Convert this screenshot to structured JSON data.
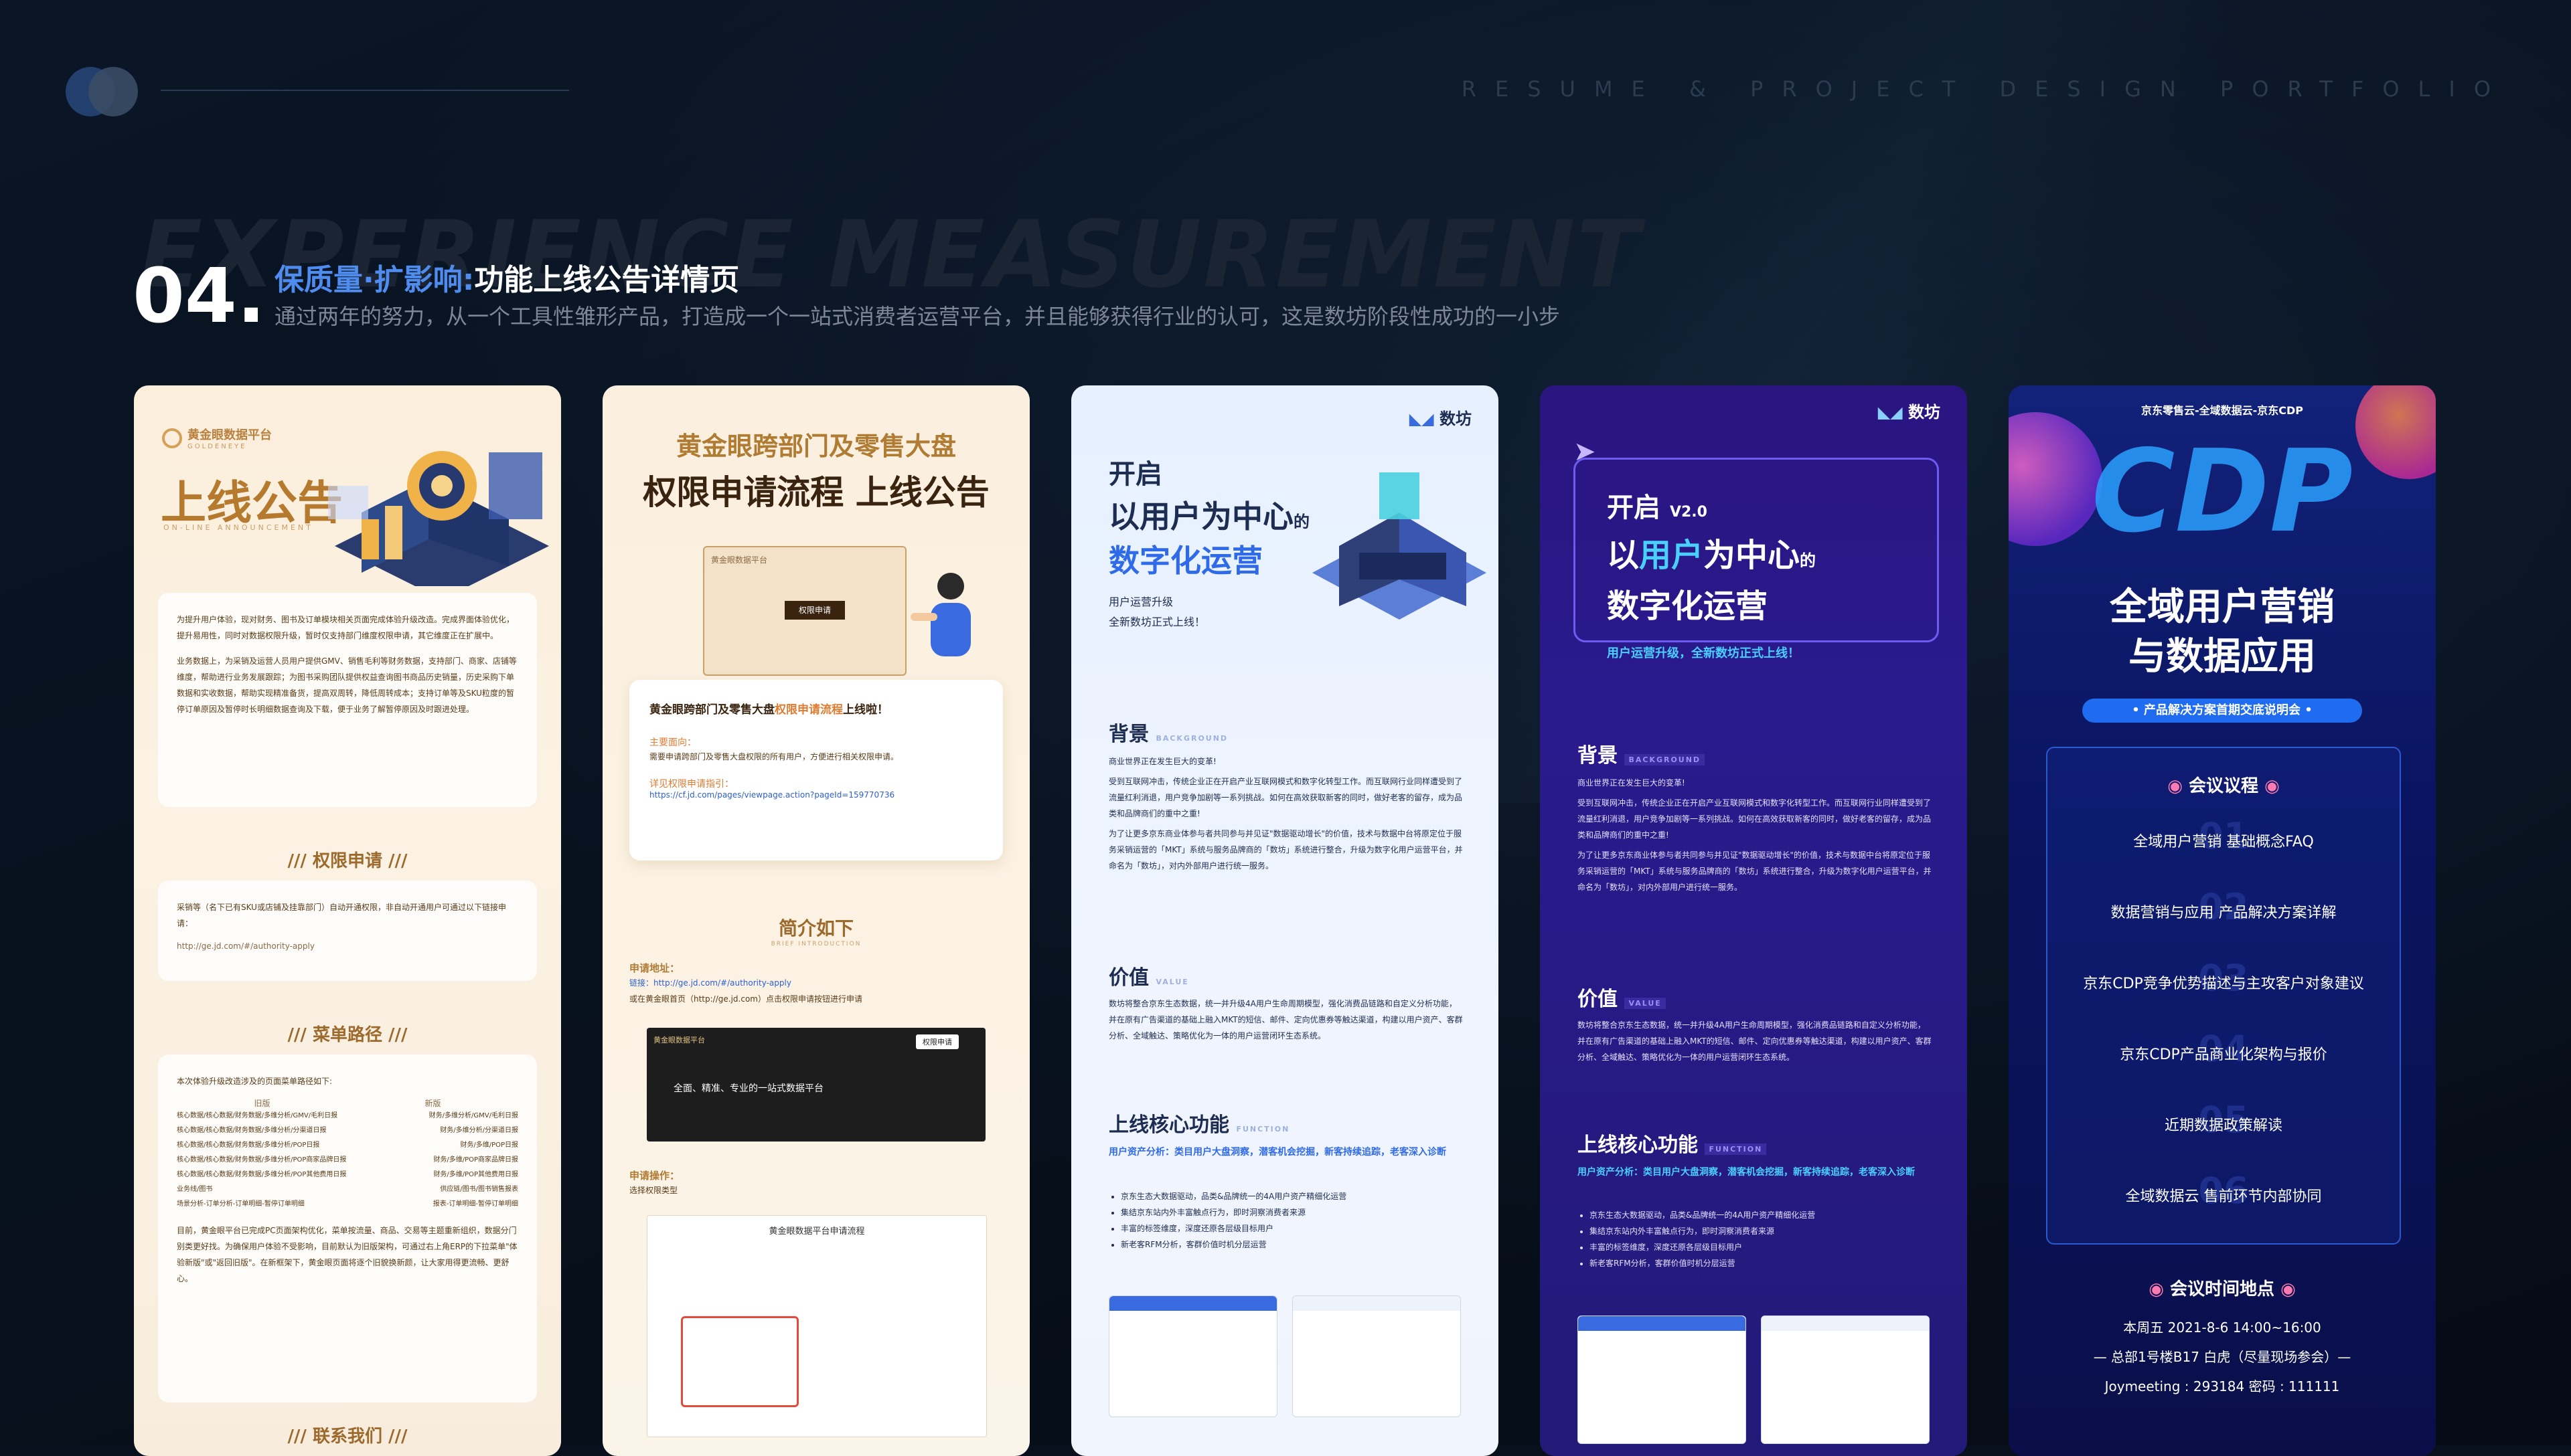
{
  "header": {
    "tagline": "RESUME & PROJECT DESIGN PORTFOLIO",
    "ghost": "EXPERIENCE MEASUREMENT",
    "number": "04.",
    "title_highlight": "保质量·扩影响:",
    "title_rest": "功能上线公告详情页",
    "subtitle": "通过两年的努力，从一个工具性雏形产品，打造成一个一站式消费者运营平台，并且能够获得行业的认可，这是数坊阶段性成功的一小步"
  },
  "card1": {
    "brand": "黄金眼数据平台",
    "brand_en": "GOLDENEYE",
    "title": "上线公告",
    "title_en": "ON-LINE ANNOUNCEMENT",
    "intro": "为提升用户体验，现对财务、图书及订单模块相关页面完成体验升级改造。完成界面体验优化，提升易用性，同时对数据权限升级，暂时仅支持部门维度权限申请，其它维度正在扩展中。",
    "intro2": "业务数据上，为采销及运营人员用户提供GMV、销售毛利等财务数据，支持部门、商家、店铺等维度，帮助进行业务发展跟踪；为图书采购团队提供权益查询图书商品历史销量，历史采购下单数据和实收数据，帮助实现精准备货，提高双周转，降低周转成本；支持订单等及SKU粒度的暂停订单原因及暂停时长明细数据查询及下载，便于业务了解暂停原因及时跟进处理。",
    "sec1": "权限申请",
    "perm_text": "采销等（名下已有SKU或店铺及挂靠部门）自动开通权限，非自动开通用户可通过以下链接申请：",
    "perm_link": "http://ge.jd.com/#/authority-apply",
    "sec2": "菜单路径",
    "menu_intro": "本次体验升级改造涉及的页面菜单路径如下:",
    "col_old": "旧版",
    "col_new": "新版",
    "menu_rows": [
      [
        "核心数据/核心数据/财务数据/多维分析/GMV/毛利日报",
        "财务/多维分析/GMV/毛利日报"
      ],
      [
        "核心数据/核心数据/财务数据/多维分析/分渠道日报",
        "财务/多维分析/分渠道日报"
      ],
      [
        "核心数据/核心数据/财务数据/多维分析/POP日报",
        "财务/多维/POP日报"
      ],
      [
        "核心数据/核心数据/财务数据/多维分析/POP商家品牌日报",
        "财务/多维/POP商家品牌日报"
      ],
      [
        "核心数据/核心数据/财务数据/多维分析/POP其他费用日报",
        "财务/多维/POP其他费用日报"
      ],
      [
        "业务线/图书",
        "供应链/图书/图书销售报表"
      ],
      [
        "场景分析-订单分析-订单明细-暂停订单明细",
        "报表-订单明细-暂停订单明细"
      ]
    ],
    "outro": "目前，黄金眼平台已完成PC页面架构优化，菜单按流量、商品、交易等主题重新组织，数据分门别类更好找。为确保用户体验不受影响，目前默认为旧版架构，可通过右上角ERP的下拉菜单\"体验新版\"或\"返回旧版\"。在新框架下，黄金眼页面将逐个旧貌换新颜，让大家用得更流畅、更舒心。",
    "sec3": "联系我们"
  },
  "card2": {
    "title1": "黄金眼跨部门及零售大盘",
    "title2": "权限申请流程 上线公告",
    "screen_brand": "黄金眼数据平台",
    "screen_button": "权限申请",
    "notice_head": "黄金眼跨部门及零售大盘",
    "notice_head_hl": "权限申请流程",
    "notice_head_tail": "上线啦！",
    "content_label": "主要面向：",
    "content_text": "需要申请跨部门及零售大盘权限的所有用户，方便进行相关权限申请。",
    "guide_label": "详见权限申请指引：",
    "guide_link": "https://cf.jd.com/pages/viewpage.action?pageId=159770736",
    "sec": "简介如下",
    "sec_en": "BRIEF INTRODUCTION",
    "addr_label": "申请地址：",
    "addr_text1": "链接：http://ge.jd.com/#/authority-apply",
    "addr_text2": "或在黄金眼首页（http://ge.jd.com）点击权限申请按钮进行申请",
    "shot_brand": "黄金眼数据平台",
    "shot_btn": "权限申请",
    "shot_slogan": "全面、精准、专业的一站式数据平台",
    "op_label": "申请操作：",
    "op_text": "选择权限类型",
    "form_title": "黄金眼数据平台申请流程"
  },
  "card3": {
    "logo": "数坊",
    "h1": "开启",
    "h2": "以用户为中心",
    "h2_tail": "的",
    "h3": "数字化运营",
    "sub1": "用户运营升级",
    "sub2": "全新数坊正式上线！",
    "sec1": "背景",
    "sec1_en": "BACKGROUND",
    "bg_text1": "商业世界正在发生巨大的变革!",
    "bg_text2": "受到互联网冲击，传统企业正在开启产业互联网模式和数字化转型工作。而互联网行业同样遭受到了流量红利消退，用户竞争加剧等一系列挑战。如何在高效获取新客的同时，做好老客的留存，成为品类和品牌商们的重中之重!",
    "bg_text3": "为了让更多京东商业体参与者共同参与并见证\"数据驱动增长\"的价值，技术与数据中台将原定位于服务采销运营的「MKT」系统与服务品牌商的「数坊」系统进行整合，升级为数字化用户运营平台，并命名为「数坊」，对内外部用户进行统一服务。",
    "sec2": "价值",
    "sec2_en": "VALUE",
    "val_text": "数坊将整合京东生态数据，统一并升级4A用户生命周期模型，强化消费品链路和自定义分析功能，并在原有广告渠道的基础上融入MKT的短信、邮件、定向优惠券等触达渠道，构建以用户资产、客群分析、全域触达、策略优化为一体的用户运营闭环生态系统。",
    "sec3": "上线核心功能",
    "sec3_en": "FUNCTION",
    "func_head": "用户资产分析：类目用户大盘洞察，潜客机会挖掘，新客持续追踪，老客深入诊断",
    "func_items": [
      "京东生态大数据驱动，品类&品牌统一的4A用户资产精细化运营",
      "集结京东站内外丰富触点行为，即时洞察消费者来源",
      "丰富的标签维度，深度还原各层级目标用户",
      "新老客RFM分析，客群价值时机分层运营"
    ]
  },
  "card4": {
    "logo": "数坊",
    "h1": "开启",
    "ver": "V2.0",
    "h2a": "以",
    "h2b": "用户",
    "h2c": "为中心",
    "h2_tail": "的",
    "h3": "数字化运营",
    "sub": "用户运营升级，全新数坊正式上线！",
    "sec1": "背景",
    "sec1_en": "BACKGROUND",
    "bg_text1": "商业世界正在发生巨大的变革!",
    "bg_text2": "受到互联网冲击，传统企业正在开启产业互联网模式和数字化转型工作。而互联网行业同样遭受到了流量红利消退，用户竞争加剧等一系列挑战。如何在高效获取新客的同时，做好老客的留存，成为品类和品牌商们的重中之重!",
    "bg_text3": "为了让更多京东商业体参与者共同参与并见证\"数据驱动增长\"的价值，技术与数据中台将原定位于服务采销运营的「MKT」系统与服务品牌商的「数坊」系统进行整合，升级为数字化用户运营平台，并命名为「数坊」，对内外部用户进行统一服务。",
    "sec2": "价值",
    "sec2_en": "VALUE",
    "val_text": "数坊将整合京东生态数据，统一并升级4A用户生命周期模型，强化消费品链路和自定义分析功能，并在原有广告渠道的基础上融入MKT的短信、邮件、定向优惠券等触达渠道，构建以用户资产、客群分析、全域触达、策略优化为一体的用户运营闭环生态系统。",
    "sec3": "上线核心功能",
    "sec3_en": "FUNCTION",
    "func_head": "用户资产分析：类目用户大盘洞察，潜客机会挖掘，新客持续追踪，老客深入诊断",
    "func_items": [
      "京东生态大数据驱动，品类&品牌统一的4A用户资产精细化运营",
      "集结京东站内外丰富触点行为，即时洞察消费者来源",
      "丰富的标签维度，深度还原各层级目标用户",
      "新老客RFM分析，客群价值时机分层运营"
    ]
  },
  "card5": {
    "top": "京东零售云-全域数据云-京东CDP",
    "big": "CDP",
    "h1": "全域用户营销",
    "h2": "与数据应用",
    "badge": "• 产品解决方案首期交底说明会 •",
    "agenda_title": "会议议程",
    "agenda": [
      {
        "num": "01",
        "text": "全域用户营销 基础概念FAQ"
      },
      {
        "num": "02",
        "text": "数据营销与应用 产品解决方案详解"
      },
      {
        "num": "03",
        "text": "京东CDP竞争优势描述与主攻客户对象建议"
      },
      {
        "num": "04",
        "text": "京东CDP产品商业化架构与报价"
      },
      {
        "num": "05",
        "text": "近期数据政策解读"
      },
      {
        "num": "06",
        "text": "全域数据云 售前环节内部协同"
      }
    ],
    "time_title": "会议时间地点",
    "time": "本周五  2021-8-6  14:00~16:00",
    "place": "— 总部1号楼B17 白虎（尽量现场参会）—",
    "meeting": "Joymeeting : 293184   密码 : 111111"
  }
}
